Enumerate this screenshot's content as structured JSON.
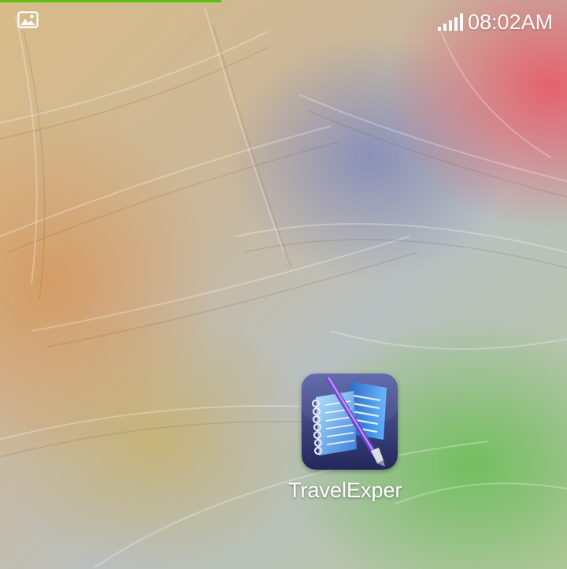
{
  "status_bar": {
    "notification_icon": "gallery-icon",
    "signal_icon": "signal-bars-icon",
    "time": "08:02AM"
  },
  "progress": {
    "fraction": 0.39,
    "color": "#5cc010"
  },
  "home_screen": {
    "wallpaper": "colorful-feathers",
    "apps": [
      {
        "label": "TravelExper",
        "icon": "notebook-pen-icon"
      }
    ]
  },
  "colors": {
    "text": "#ffffff",
    "icon_bg": "#2e3470",
    "icon_accent": "#3d8de0"
  }
}
